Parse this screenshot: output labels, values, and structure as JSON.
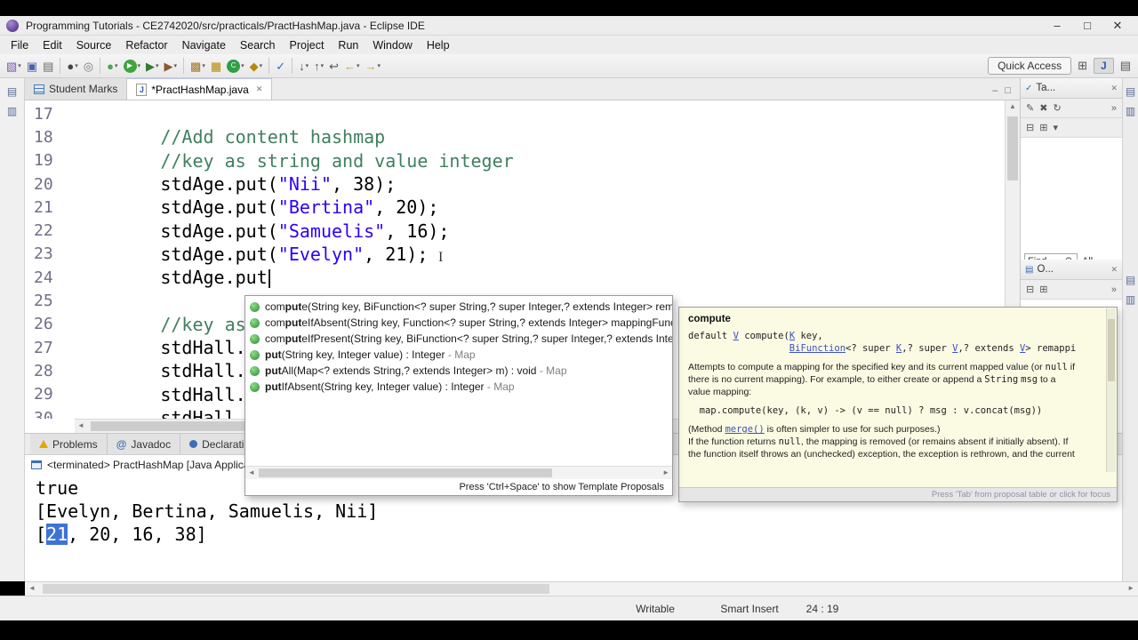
{
  "window": {
    "title": "Programming Tutorials - CE2742020/src/practicals/PractHashMap.java - Eclipse IDE"
  },
  "icons": {
    "minimize": "–",
    "maximize": "□",
    "close": "✕",
    "tab_close": "✕",
    "java_file": "J",
    "at": "@",
    "chevrons": "»",
    "dropdown": "▾",
    "left_arrow": "◄",
    "right_arrow": "►",
    "up_arrow": "▲",
    "down_arrow": "▼",
    "new_task": "✎",
    "delete_task": "✖",
    "refresh": "↻",
    "view_menu": "⊞",
    "collapse_all": "⊟",
    "stacked_view": "▤",
    "stacked_view2": "▥",
    "outline": "▤",
    "task_check": "✓",
    "ibeam": "I"
  },
  "menubar": [
    "File",
    "Edit",
    "Source",
    "Refactor",
    "Navigate",
    "Search",
    "Project",
    "Run",
    "Window",
    "Help"
  ],
  "toolbar": {
    "quick_access": "Quick Access",
    "icons": [
      {
        "name": "new-wizard-icon",
        "g": "▧",
        "c": "#7a58b8",
        "dd": true
      },
      {
        "name": "save-icon",
        "g": "▣",
        "c": "#4a5fae"
      },
      {
        "name": "print-icon",
        "g": "▤",
        "c": "#666666"
      },
      {
        "sep": true
      },
      {
        "name": "open-console-icon",
        "g": "●",
        "c": "#444444",
        "dd": true
      },
      {
        "name": "search-icon",
        "g": "◎",
        "c": "#777777"
      },
      {
        "sep": true
      },
      {
        "name": "debug-icon",
        "g": "●",
        "c": "#4ca64c",
        "dd": true
      },
      {
        "name": "run-icon",
        "g": "▶",
        "round": "#3fa53f",
        "dd": true
      },
      {
        "name": "external-tools-icon",
        "g": "▶",
        "c": "#2e7d32",
        "dd": true
      },
      {
        "name": "coverage-icon",
        "g": "▶",
        "c": "#8a5a2a",
        "dd": true
      },
      {
        "sep": true
      },
      {
        "name": "new-java-project-icon",
        "g": "▩",
        "c": "#a07828",
        "dd": true
      },
      {
        "name": "new-package-icon",
        "g": "▦",
        "c": "#b58900"
      },
      {
        "name": "new-class-icon",
        "g": "C",
        "round": "#2f9e44",
        "dd": true
      },
      {
        "name": "new-jar-icon",
        "g": "◆",
        "c": "#b8860b",
        "dd": true
      },
      {
        "sep": true
      },
      {
        "name": "task-icon",
        "g": "✓",
        "c": "#2a6fbd"
      },
      {
        "sep": true
      },
      {
        "name": "next-annotation-icon",
        "g": "↓",
        "c": "#555555",
        "dd": true
      },
      {
        "name": "previous-annotation-icon",
        "g": "↑",
        "c": "#555555",
        "dd": true
      },
      {
        "name": "last-edit-location-icon",
        "g": "↩",
        "c": "#555555"
      },
      {
        "name": "back-icon",
        "g": "←",
        "c": "#c9a227",
        "dd": true
      },
      {
        "name": "forward-icon",
        "g": "→",
        "c": "#c9a227",
        "dd": true
      }
    ]
  },
  "editor": {
    "tabs": [
      {
        "label": "Student Marks"
      },
      {
        "label": "*PractHashMap.java"
      }
    ],
    "lines": [
      {
        "num": "17",
        "segs": []
      },
      {
        "num": "18",
        "segs": [
          {
            "t": "        "
          },
          {
            "t": "//Add content hashmap",
            "s": "comment"
          }
        ]
      },
      {
        "num": "19",
        "segs": [
          {
            "t": "        "
          },
          {
            "t": "//key as string and value integer",
            "s": "comment"
          }
        ]
      },
      {
        "num": "20",
        "segs": [
          {
            "t": "        stdAge.put("
          },
          {
            "t": "\"Nii\"",
            "s": "string"
          },
          {
            "t": ", 38);"
          }
        ]
      },
      {
        "num": "21",
        "segs": [
          {
            "t": "        stdAge.put("
          },
          {
            "t": "\"Bertina\"",
            "s": "string"
          },
          {
            "t": ", 20);"
          }
        ]
      },
      {
        "num": "22",
        "segs": [
          {
            "t": "        stdAge.put("
          },
          {
            "t": "\"Samuelis\"",
            "s": "string"
          },
          {
            "t": ", 16);"
          }
        ]
      },
      {
        "num": "23",
        "segs": [
          {
            "t": "        stdAge.put("
          },
          {
            "t": "\"Evelyn\"",
            "s": "string"
          },
          {
            "t": ", 21);"
          }
        ]
      },
      {
        "num": "24",
        "segs": [
          {
            "t": "        stdAge.put"
          }
        ],
        "cursor": true
      },
      {
        "num": "25",
        "segs": []
      },
      {
        "num": "26",
        "segs": [
          {
            "t": "        "
          },
          {
            "t": "//key as",
            "s": "comment"
          }
        ]
      },
      {
        "num": "27",
        "segs": [
          {
            "t": "        stdHall."
          }
        ]
      },
      {
        "num": "28",
        "segs": [
          {
            "t": "        stdHall."
          }
        ]
      },
      {
        "num": "29",
        "segs": [
          {
            "t": "        stdHall."
          }
        ]
      },
      {
        "num": "30",
        "segs": [
          {
            "t": "        stdHall"
          }
        ]
      }
    ]
  },
  "completion": {
    "items": [
      {
        "pre": "com",
        "match": "put",
        "post": "e(String key, BiFunction<? super String,? super Integer,? extends Integer> remappingFu",
        "origin": ""
      },
      {
        "pre": "com",
        "match": "put",
        "post": "eIfAbsent(String key, Function<? super String,? extends Integer> mappingFunction) : I",
        "origin": ""
      },
      {
        "pre": "com",
        "match": "put",
        "post": "eIfPresent(String key, BiFunction<? super String,? super Integer,? extends Integer> rem",
        "origin": ""
      },
      {
        "pre": "",
        "match": "put",
        "post": "(String key, Integer value) : Integer",
        "origin": " - Map"
      },
      {
        "pre": "",
        "match": "put",
        "post": "All(Map<? extends String,? extends Integer> m) : void",
        "origin": " - Map"
      },
      {
        "pre": "",
        "match": "put",
        "post": "IfAbsent(String key, Integer value) : Integer",
        "origin": " - Map"
      }
    ],
    "hint": "Press 'Ctrl+Space' to show Template Proposals"
  },
  "javadoc": {
    "title": "compute",
    "lines": [
      {
        "mono": true,
        "segs": [
          {
            "t": "default "
          },
          {
            "t": "V",
            "s": "link"
          },
          {
            "t": " compute("
          },
          {
            "t": "K",
            "s": "link"
          },
          {
            "t": " key,"
          }
        ]
      },
      {
        "mono": true,
        "segs": [
          {
            "t": "                  "
          },
          {
            "t": "BiFunction",
            "s": "link"
          },
          {
            "t": "<? super "
          },
          {
            "t": "K",
            "s": "link"
          },
          {
            "t": ",? super "
          },
          {
            "t": "V",
            "s": "link"
          },
          {
            "t": ",? extends "
          },
          {
            "t": "V",
            "s": "link"
          },
          {
            "t": "> remappi"
          }
        ]
      },
      {
        "segs": []
      },
      {
        "segs": [
          {
            "t": "Attempts to compute a mapping for the specified key and its current mapped value (or "
          },
          {
            "t": "null",
            "s": "mono"
          },
          {
            "t": " if"
          }
        ]
      },
      {
        "segs": [
          {
            "t": "there is no current mapping). For example, to either create or append a "
          },
          {
            "t": "String",
            "s": "mono"
          },
          {
            "t": " "
          },
          {
            "t": "msg",
            "s": "mono"
          },
          {
            "t": " to a"
          }
        ]
      },
      {
        "segs": [
          {
            "t": "value mapping:"
          }
        ]
      },
      {
        "segs": []
      },
      {
        "mono": true,
        "segs": [
          {
            "t": "  map.compute(key, (k, v) -> (v == null) ? msg : v.concat(msg))"
          }
        ]
      },
      {
        "segs": []
      },
      {
        "segs": [
          {
            "t": "(Method "
          },
          {
            "t": "merge()",
            "s": "monolink"
          },
          {
            "t": " is often simpler to use for such purposes.)"
          }
        ]
      },
      {
        "segs": [
          {
            "t": "If the function returns "
          },
          {
            "t": "null",
            "s": "mono"
          },
          {
            "t": ", the mapping is removed (or remains absent if initially absent). If"
          }
        ]
      },
      {
        "segs": [
          {
            "t": "the function itself throws an (unchecked) exception, the exception is rethrown, and the current"
          }
        ]
      }
    ],
    "hint": "Press 'Tab' from proposal table or click for focus"
  },
  "console": {
    "tabs": [
      {
        "label": "Problems",
        "icon": "problems"
      },
      {
        "label": "Javadoc",
        "icon": "javadoc"
      },
      {
        "label": "Declaration",
        "icon": "declaration"
      },
      {
        "label": "",
        "icon": "console",
        "active": true
      }
    ],
    "header": "<terminated> PractHashMap [Java Application]",
    "output": [
      [
        {
          "t": "true"
        }
      ],
      [
        {
          "t": "[Evelyn, Bertina, Samuelis, Nii]"
        }
      ],
      [
        {
          "t": "["
        },
        {
          "t": "21",
          "s": "sel"
        },
        {
          "t": ", 20, 16, 38]"
        }
      ]
    ]
  },
  "right_panel": {
    "task_tab": "Ta...",
    "outline_tab": "O...",
    "find_label": "Find",
    "all_label": "All"
  },
  "statusbar": {
    "writable": "Writable",
    "insert_mode": "Smart Insert",
    "caret_position": "24 : 19"
  }
}
